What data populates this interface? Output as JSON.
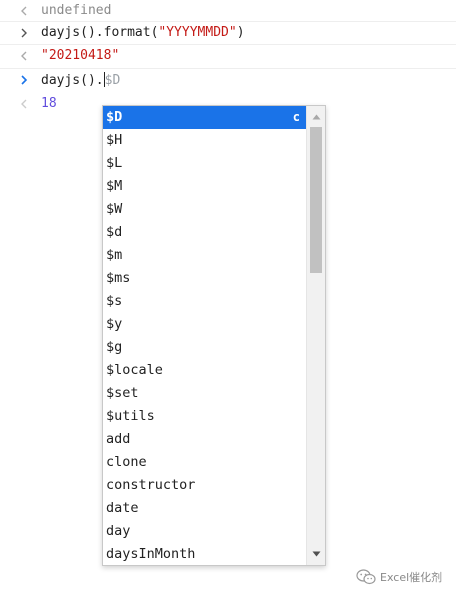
{
  "console": {
    "lines": [
      {
        "kind": "result",
        "text": "undefined"
      },
      {
        "kind": "input",
        "code_prefix": "dayjs().format(",
        "code_string": "\"YYYYMMDD\"",
        "code_suffix": ")"
      },
      {
        "kind": "result",
        "text": "\"20210418\""
      },
      {
        "kind": "input_active",
        "typed": "dayjs().",
        "suggestion": "$D"
      },
      {
        "kind": "result_preview",
        "text": "18"
      }
    ]
  },
  "autocomplete": {
    "selected_shortcut": "c",
    "items": [
      "$D",
      "$H",
      "$L",
      "$M",
      "$W",
      "$d",
      "$m",
      "$ms",
      "$s",
      "$y",
      "$g",
      "$locale",
      "$set",
      "$utils",
      "add",
      "clone",
      "constructor",
      "date",
      "day",
      "daysInMonth"
    ]
  },
  "watermark": {
    "text": "Excel催化剂",
    "icon": "wechat-icon"
  },
  "colors": {
    "selection": "#1a73e8",
    "string": "#c41a16",
    "number": "#1c00cf",
    "prompt": "#1a73e8"
  }
}
